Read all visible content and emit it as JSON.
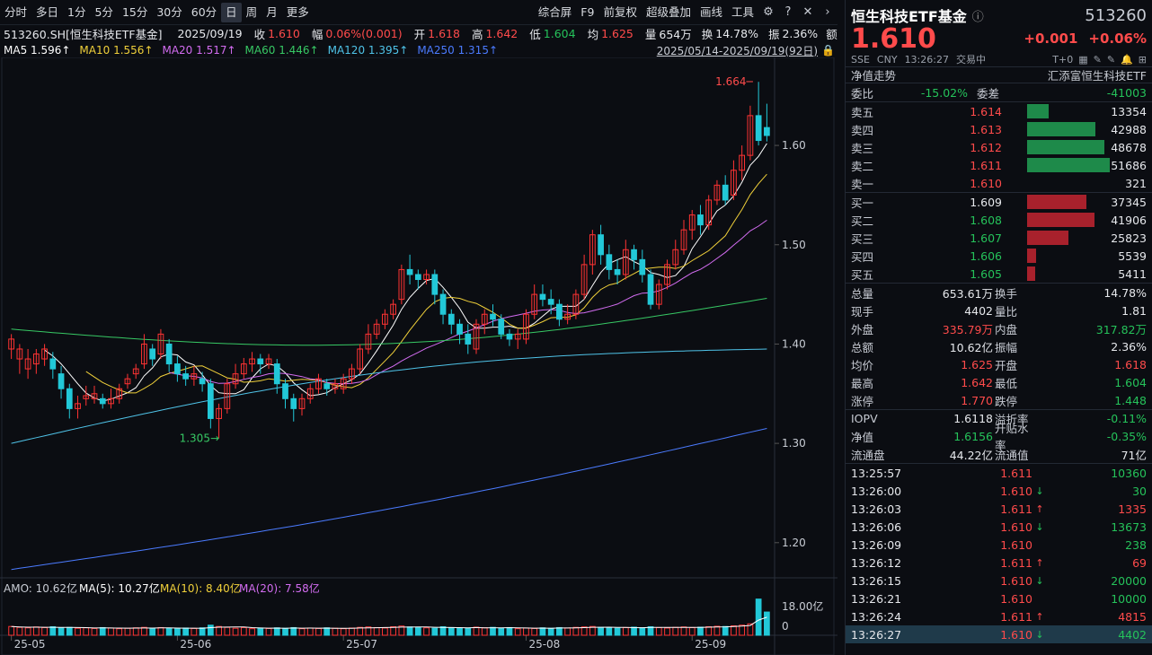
{
  "toolbar": {
    "items": [
      "分时",
      "多日",
      "1分",
      "5分",
      "15分",
      "30分",
      "60分",
      "日",
      "周",
      "月",
      "更多"
    ],
    "active": "日",
    "right": [
      "综合屏",
      "F9",
      "前复权",
      "超级叠加",
      "画线",
      "工具"
    ]
  },
  "info": {
    "code": "513260.SH[恒生科技ETF基金]",
    "date": "2025/09/19",
    "close_l": "收",
    "close": "1.610",
    "amp_l": "幅",
    "amp": "0.06%(0.001)",
    "open_l": "开",
    "open": "1.618",
    "high_l": "高",
    "high": "1.642",
    "low_l": "低",
    "low": "1.604",
    "avg_l": "均",
    "avg": "1.625",
    "vol_l": "量",
    "vol": "654万",
    "turn_l": "换",
    "turn": "14.78%",
    "swing_l": "振",
    "swing": "2.36%",
    "more": "额"
  },
  "ma": {
    "ma5": "MA5 1.596↑",
    "ma10": "MA10 1.556↑",
    "ma20": "MA20 1.517↑",
    "ma60": "MA60 1.446↑",
    "ma120": "MA120 1.395↑",
    "ma250": "MA250 1.315↑",
    "range": "2025/05/14-2025/09/19(92日)"
  },
  "amo": {
    "amo": "AMO: 10.62亿",
    "ma5": "MA(5): 10.27亿",
    "ma10": "MA(10): 8.40亿",
    "ma20": "MA(20): 7.58亿",
    "ymax": "18.00亿",
    "y0": "0"
  },
  "colors": {
    "up": "#ff3333",
    "down": "#22c8d8"
  },
  "chart_data": {
    "type": "candlestick",
    "ylim": [
      1.17,
      1.685
    ],
    "yticks": [
      "1.60",
      "1.50",
      "1.40",
      "1.30",
      "1.20"
    ],
    "ytick_values": [
      1.6,
      1.5,
      1.4,
      1.3,
      1.2
    ],
    "xticks": [
      "25-05",
      "25-06",
      "25-07",
      "25-08",
      "25-09"
    ],
    "xtick_index": [
      0,
      20,
      40,
      62,
      82
    ],
    "high_label": "1.664",
    "low_label": "1.305",
    "candles": [
      [
        1.395,
        1.405,
        1.41,
        1.385
      ],
      [
        1.385,
        1.395,
        1.4,
        1.37
      ],
      [
        1.375,
        1.385,
        1.395,
        1.365
      ],
      [
        1.38,
        1.39,
        1.395,
        1.37
      ],
      [
        1.385,
        1.395,
        1.4,
        1.378
      ],
      [
        1.385,
        1.375,
        1.392,
        1.365
      ],
      [
        1.37,
        1.355,
        1.378,
        1.345
      ],
      [
        1.355,
        1.335,
        1.36,
        1.325
      ],
      [
        1.335,
        1.34,
        1.348,
        1.325
      ],
      [
        1.345,
        1.348,
        1.358,
        1.338
      ],
      [
        1.345,
        1.35,
        1.358,
        1.34
      ],
      [
        1.345,
        1.34,
        1.35,
        1.335
      ],
      [
        1.34,
        1.345,
        1.355,
        1.335
      ],
      [
        1.345,
        1.355,
        1.36,
        1.34
      ],
      [
        1.36,
        1.365,
        1.37,
        1.355
      ],
      [
        1.37,
        1.375,
        1.38,
        1.365
      ],
      [
        1.38,
        1.4,
        1.41,
        1.375
      ],
      [
        1.395,
        1.385,
        1.4,
        1.378
      ],
      [
        1.39,
        1.41,
        1.415,
        1.385
      ],
      [
        1.4,
        1.38,
        1.405,
        1.372
      ],
      [
        1.38,
        1.37,
        1.388,
        1.362
      ],
      [
        1.37,
        1.365,
        1.378,
        1.358
      ],
      [
        1.365,
        1.37,
        1.378,
        1.358
      ],
      [
        1.365,
        1.36,
        1.372,
        1.352
      ],
      [
        1.36,
        1.325,
        1.365,
        1.315
      ],
      [
        1.325,
        1.335,
        1.34,
        1.305
      ],
      [
        1.335,
        1.36,
        1.365,
        1.33
      ],
      [
        1.36,
        1.37,
        1.38,
        1.355
      ],
      [
        1.37,
        1.38,
        1.386,
        1.365
      ],
      [
        1.38,
        1.385,
        1.392,
        1.372
      ],
      [
        1.385,
        1.38,
        1.39,
        1.37
      ],
      [
        1.38,
        1.385,
        1.39,
        1.375
      ],
      [
        1.38,
        1.36,
        1.385,
        1.35
      ],
      [
        1.36,
        1.345,
        1.365,
        1.335
      ],
      [
        1.345,
        1.335,
        1.35,
        1.322
      ],
      [
        1.335,
        1.345,
        1.35,
        1.328
      ],
      [
        1.345,
        1.355,
        1.36,
        1.34
      ],
      [
        1.355,
        1.365,
        1.37,
        1.35
      ],
      [
        1.36,
        1.355,
        1.365,
        1.348
      ],
      [
        1.355,
        1.36,
        1.365,
        1.35
      ],
      [
        1.355,
        1.365,
        1.37,
        1.35
      ],
      [
        1.365,
        1.375,
        1.38,
        1.36
      ],
      [
        1.375,
        1.395,
        1.4,
        1.37
      ],
      [
        1.395,
        1.41,
        1.42,
        1.39
      ],
      [
        1.41,
        1.42,
        1.425,
        1.405
      ],
      [
        1.42,
        1.43,
        1.435,
        1.415
      ],
      [
        1.43,
        1.44,
        1.445,
        1.425
      ],
      [
        1.445,
        1.475,
        1.48,
        1.44
      ],
      [
        1.475,
        1.47,
        1.49,
        1.46
      ],
      [
        1.47,
        1.465,
        1.475,
        1.455
      ],
      [
        1.465,
        1.47,
        1.475,
        1.46
      ],
      [
        1.47,
        1.45,
        1.475,
        1.44
      ],
      [
        1.45,
        1.43,
        1.455,
        1.42
      ],
      [
        1.43,
        1.42,
        1.435,
        1.41
      ],
      [
        1.42,
        1.41,
        1.425,
        1.4
      ],
      [
        1.41,
        1.4,
        1.42,
        1.39
      ],
      [
        1.395,
        1.42,
        1.425,
        1.39
      ],
      [
        1.42,
        1.43,
        1.435,
        1.41
      ],
      [
        1.43,
        1.425,
        1.44,
        1.418
      ],
      [
        1.425,
        1.41,
        1.43,
        1.405
      ],
      [
        1.41,
        1.405,
        1.415,
        1.398
      ],
      [
        1.405,
        1.41,
        1.415,
        1.395
      ],
      [
        1.405,
        1.43,
        1.435,
        1.4
      ],
      [
        1.43,
        1.45,
        1.46,
        1.425
      ],
      [
        1.45,
        1.445,
        1.46,
        1.438
      ],
      [
        1.445,
        1.44,
        1.455,
        1.43
      ],
      [
        1.44,
        1.425,
        1.445,
        1.418
      ],
      [
        1.425,
        1.43,
        1.44,
        1.42
      ],
      [
        1.43,
        1.45,
        1.455,
        1.425
      ],
      [
        1.45,
        1.48,
        1.49,
        1.445
      ],
      [
        1.48,
        1.51,
        1.515,
        1.47
      ],
      [
        1.51,
        1.49,
        1.52,
        1.48
      ],
      [
        1.49,
        1.475,
        1.5,
        1.465
      ],
      [
        1.475,
        1.47,
        1.485,
        1.46
      ],
      [
        1.47,
        1.495,
        1.505,
        1.465
      ],
      [
        1.495,
        1.485,
        1.5,
        1.475
      ],
      [
        1.485,
        1.47,
        1.495,
        1.462
      ],
      [
        1.47,
        1.44,
        1.475,
        1.435
      ],
      [
        1.44,
        1.46,
        1.465,
        1.435
      ],
      [
        1.46,
        1.48,
        1.485,
        1.455
      ],
      [
        1.48,
        1.495,
        1.505,
        1.475
      ],
      [
        1.495,
        1.515,
        1.525,
        1.49
      ],
      [
        1.515,
        1.53,
        1.535,
        1.505
      ],
      [
        1.53,
        1.52,
        1.54,
        1.51
      ],
      [
        1.52,
        1.545,
        1.55,
        1.515
      ],
      [
        1.545,
        1.56,
        1.565,
        1.54
      ],
      [
        1.56,
        1.545,
        1.57,
        1.54
      ],
      [
        1.55,
        1.575,
        1.585,
        1.545
      ],
      [
        1.575,
        1.59,
        1.6,
        1.565
      ],
      [
        1.59,
        1.63,
        1.64,
        1.585
      ],
      [
        1.63,
        1.605,
        1.664,
        1.6
      ],
      [
        1.618,
        1.61,
        1.642,
        1.604
      ]
    ],
    "volumes": [
      4.0,
      3.6,
      3.4,
      3.8,
      3.5,
      3.9,
      3.3,
      3.6,
      3.2,
      3.4,
      3.1,
      3.5,
      3.3,
      3.0,
      3.2,
      3.4,
      3.6,
      3.1,
      3.5,
      3.2,
      3.0,
      3.3,
      3.1,
      3.4,
      4.6,
      4.0,
      3.6,
      3.2,
      3.5,
      3.0,
      3.3,
      3.1,
      3.4,
      3.2,
      3.5,
      3.0,
      3.3,
      3.1,
      3.4,
      3.2,
      3.0,
      3.3,
      3.6,
      3.8,
      3.5,
      3.3,
      3.9,
      4.2,
      3.8,
      3.6,
      3.4,
      3.2,
      3.9,
      3.5,
      3.3,
      3.1,
      3.7,
      3.4,
      3.6,
      3.2,
      3.5,
      3.0,
      3.3,
      3.1,
      3.4,
      3.2,
      3.5,
      3.3,
      3.6,
      3.8,
      4.0,
      3.6,
      3.4,
      3.2,
      3.5,
      3.7,
      3.4,
      3.9,
      3.5,
      3.3,
      3.6,
      3.8,
      3.5,
      3.7,
      3.9,
      4.1,
      4.0,
      4.3,
      4.6,
      5.2,
      16.5,
      10.6
    ]
  },
  "side": {
    "name": "恒生科技ETF基金",
    "code": "513260",
    "price": "1.610",
    "change": "+0.001",
    "pct": "+0.06%",
    "exch": "SSE",
    "cur": "CNY",
    "time": "13:26:27",
    "state": "交易中",
    "t0": "T+0",
    "nav_label": "净值走势",
    "fund_name": "汇添富恒生科技ETF",
    "wb_l": "委比",
    "wb": "-15.02%",
    "wc_l": "委差",
    "wc": "-41003",
    "asks": [
      {
        "l": "卖五",
        "p": "1.614",
        "v": "13354",
        "w": 0.26
      },
      {
        "l": "卖四",
        "p": "1.613",
        "v": "42988",
        "w": 0.83
      },
      {
        "l": "卖三",
        "p": "1.612",
        "v": "48678",
        "w": 0.94
      },
      {
        "l": "卖二",
        "p": "1.611",
        "v": "51686",
        "w": 1.0
      },
      {
        "l": "卖一",
        "p": "1.610",
        "v": "321",
        "w": 0.0
      }
    ],
    "bids": [
      {
        "l": "买一",
        "p": "1.609",
        "v": "37345",
        "w": 0.72
      },
      {
        "l": "买二",
        "p": "1.608",
        "v": "41906",
        "w": 0.81
      },
      {
        "l": "买三",
        "p": "1.607",
        "v": "25823",
        "w": 0.5
      },
      {
        "l": "买四",
        "p": "1.606",
        "v": "5539",
        "w": 0.11
      },
      {
        "l": "买五",
        "p": "1.605",
        "v": "5411",
        "w": 0.1
      }
    ],
    "stats": [
      [
        "总量",
        "653.61万",
        "换手",
        "14.78%"
      ],
      [
        "现手",
        "4402",
        "量比",
        "1.81"
      ],
      [
        "外盘",
        "335.79万",
        "内盘",
        "317.82万"
      ],
      [
        "总额",
        "10.62亿",
        "振幅",
        "2.36%"
      ],
      [
        "均价",
        "1.625",
        "开盘",
        "1.618"
      ],
      [
        "最高",
        "1.642",
        "最低",
        "1.604"
      ],
      [
        "涨停",
        "1.770",
        "跌停",
        "1.448"
      ],
      [
        "IOPV",
        "1.6118",
        "溢折率",
        "-0.11%"
      ],
      [
        "净值",
        "1.6156",
        "升贴水率",
        "-0.35%"
      ],
      [
        "流通盘",
        "44.22亿",
        "流通值",
        "71亿"
      ]
    ],
    "trades": [
      [
        "13:25:57",
        "1.611",
        "",
        "10360"
      ],
      [
        "13:26:00",
        "1.610",
        "↓",
        "30"
      ],
      [
        "13:26:03",
        "1.611",
        "↑",
        "1335"
      ],
      [
        "13:26:06",
        "1.610",
        "↓",
        "13673"
      ],
      [
        "13:26:09",
        "1.610",
        "",
        "238"
      ],
      [
        "13:26:12",
        "1.611",
        "↑",
        "69"
      ],
      [
        "13:26:15",
        "1.610",
        "↓",
        "20000"
      ],
      [
        "13:26:21",
        "1.610",
        "",
        "10000"
      ],
      [
        "13:26:24",
        "1.611",
        "↑",
        "4815"
      ],
      [
        "13:26:27",
        "1.610",
        "↓",
        "4402"
      ]
    ]
  }
}
